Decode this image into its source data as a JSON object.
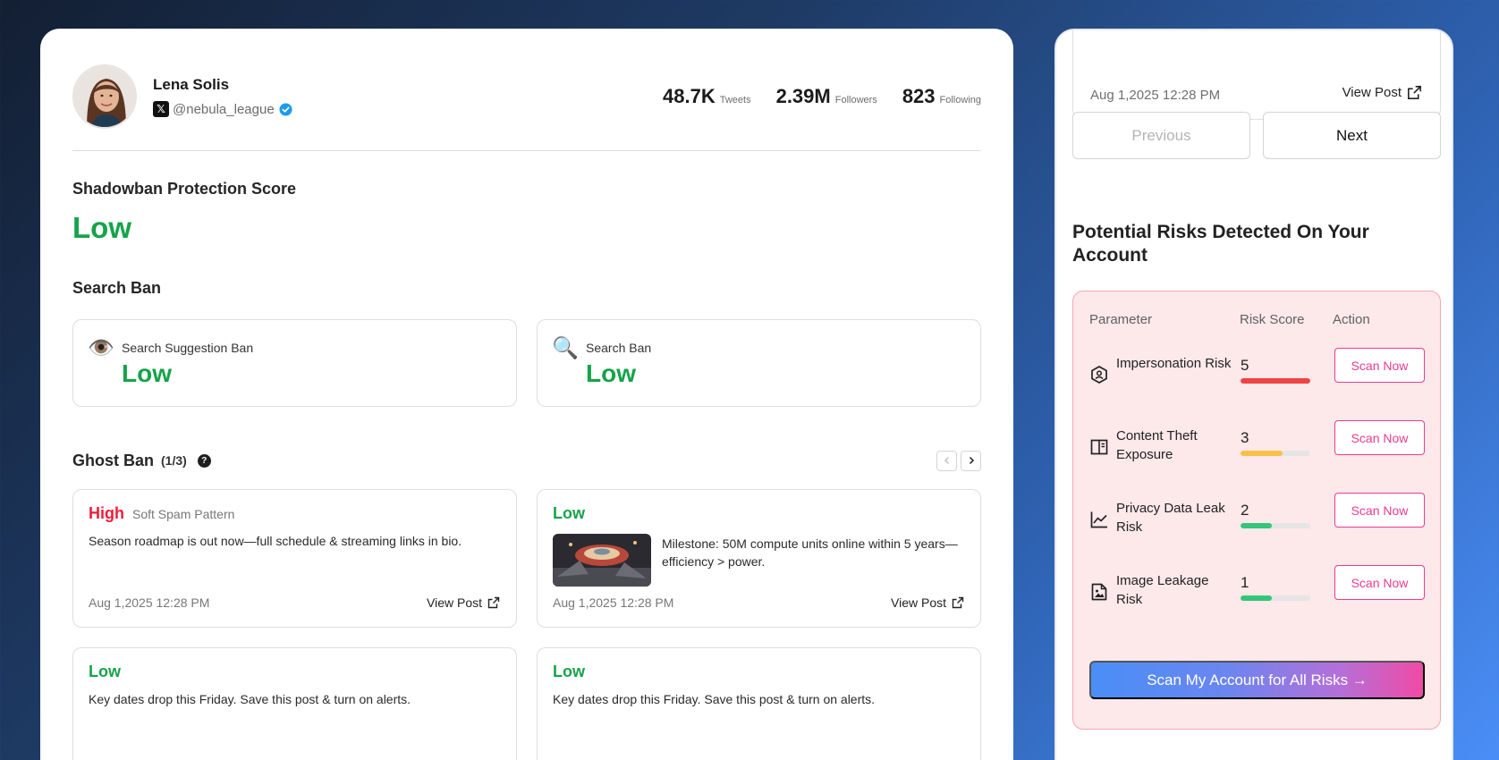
{
  "profile": {
    "name": "Lena Solis",
    "handle": "@nebula_league",
    "stats": [
      {
        "value": "48.7K",
        "label": "Tweets"
      },
      {
        "value": "2.39M",
        "label": "Followers"
      },
      {
        "value": "823",
        "label": "Following"
      }
    ]
  },
  "score": {
    "title": "Shadowban Protection Score",
    "value": "Low"
  },
  "search_ban": {
    "title": "Search Ban",
    "cards": [
      {
        "icon": "eye-icon",
        "label": "Search Suggestion Ban",
        "value": "Low"
      },
      {
        "icon": "magnifier-icon",
        "label": "Search Ban",
        "value": "Low"
      }
    ]
  },
  "ghost_ban": {
    "title": "Ghost Ban",
    "count": "(1/3)",
    "posts": [
      {
        "level": "High",
        "reason": "Soft Spam Pattern",
        "text": "Season roadmap is out now—full schedule & streaming links in bio.",
        "date": "Aug 1,2025 12:28 PM",
        "view": "View Post"
      },
      {
        "level": "Low",
        "reason": "",
        "text": "Milestone: 50M compute units online within 5 years—efficiency > power.",
        "date": "Aug 1,2025 12:28 PM",
        "view": "View Post"
      },
      {
        "level": "Low",
        "reason": "",
        "text": "Key dates drop this Friday. Save this post & turn on alerts.",
        "date": "",
        "view": ""
      },
      {
        "level": "Low",
        "reason": "",
        "text": "Key dates drop this Friday. Save this post & turn on alerts.",
        "date": "",
        "view": ""
      }
    ]
  },
  "side": {
    "top_card": {
      "date": "Aug 1,2025 12:28 PM",
      "view": "View Post"
    },
    "previous": "Previous",
    "next": "Next",
    "risk_title": "Potential Risks Detected On Your Account",
    "headers": {
      "parameter": "Parameter",
      "score": "Risk Score",
      "action": "Action"
    },
    "risks": [
      {
        "name": "Impersonation Risk",
        "score": "5",
        "level": 1.0,
        "color": "#ef4444",
        "icon": "shield-user-icon",
        "action": "Scan Now"
      },
      {
        "name": "Content Theft Exposure",
        "score": "3",
        "level": 0.6,
        "color": "#fbbf4a",
        "icon": "book-icon",
        "action": "Scan Now"
      },
      {
        "name": "Privacy Data Leak Risk",
        "score": "2",
        "level": 0.45,
        "color": "#34c57a",
        "icon": "chart-line-icon",
        "action": "Scan Now"
      },
      {
        "name": "Image Leakage Risk",
        "score": "1",
        "level": 0.45,
        "color": "#34c57a",
        "icon": "image-icon",
        "action": "Scan Now"
      }
    ],
    "scan_all": "Scan My Account for All Risks →"
  },
  "colors": {
    "low": "#16a34a",
    "high": "#ef1c3b",
    "accent": "#ec3a8f"
  }
}
